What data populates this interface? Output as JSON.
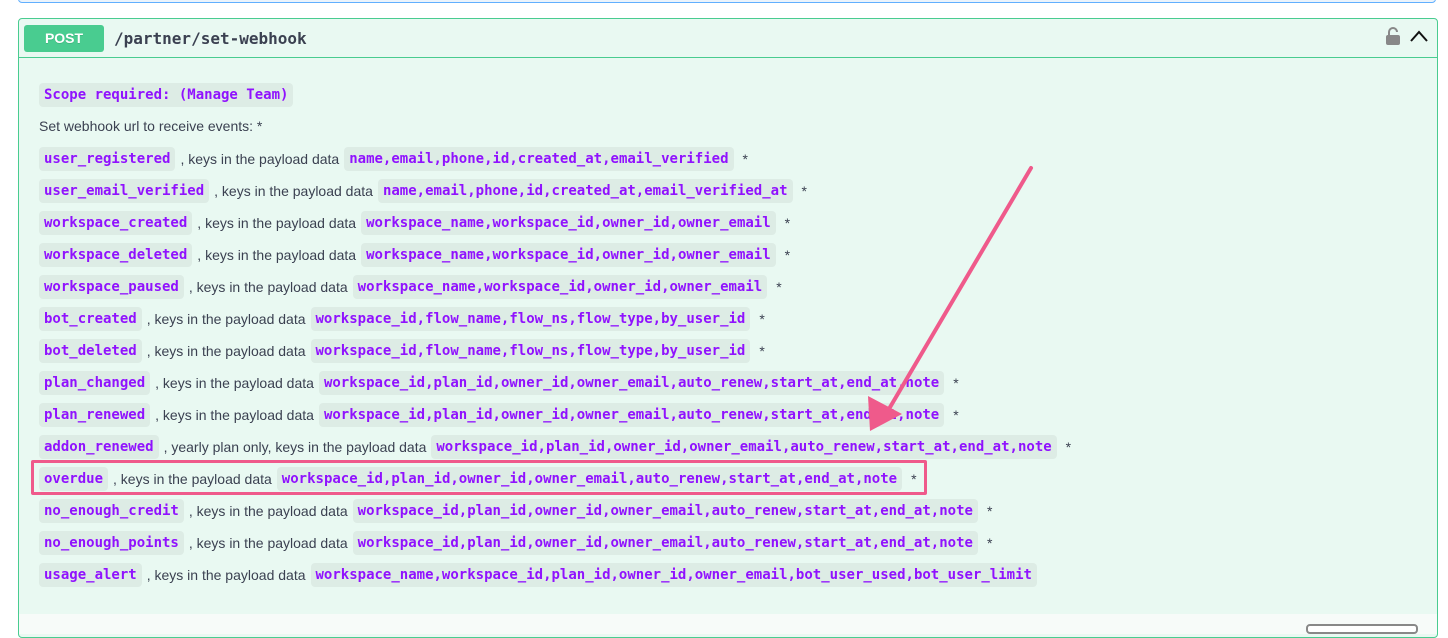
{
  "operation": {
    "method": "POST",
    "path": "/partner/set-webhook",
    "method_color": "#49cc90"
  },
  "scope": "Scope required: (Manage Team)",
  "intro": "Set webhook url to receive events: *",
  "events": [
    {
      "name": "user_registered",
      "text": ", keys in the payload data",
      "keys": "name,email,phone,id,created_at,email_verified",
      "star": "*"
    },
    {
      "name": "user_email_verified",
      "text": ", keys in the payload data",
      "keys": "name,email,phone,id,created_at,email_verified_at",
      "star": "*"
    },
    {
      "name": "workspace_created",
      "text": ", keys in the payload data",
      "keys": "workspace_name,workspace_id,owner_id,owner_email",
      "star": "*"
    },
    {
      "name": "workspace_deleted",
      "text": ", keys in the payload data",
      "keys": "workspace_name,workspace_id,owner_id,owner_email",
      "star": "*"
    },
    {
      "name": "workspace_paused",
      "text": ", keys in the payload data",
      "keys": "workspace_name,workspace_id,owner_id,owner_email",
      "star": "*"
    },
    {
      "name": "bot_created",
      "text": ", keys in the payload data",
      "keys": "workspace_id,flow_name,flow_ns,flow_type,by_user_id",
      "star": "*"
    },
    {
      "name": "bot_deleted",
      "text": ", keys in the payload data",
      "keys": "workspace_id,flow_name,flow_ns,flow_type,by_user_id",
      "star": "*"
    },
    {
      "name": "plan_changed",
      "text": ", keys in the payload data",
      "keys": "workspace_id,plan_id,owner_id,owner_email,auto_renew,start_at,end_at,note",
      "star": "*"
    },
    {
      "name": "plan_renewed",
      "text": ", keys in the payload data",
      "keys": "workspace_id,plan_id,owner_id,owner_email,auto_renew,start_at,end_at,note",
      "star": "*"
    },
    {
      "name": "addon_renewed",
      "text": ", yearly plan only, keys in the payload data",
      "keys": "workspace_id,plan_id,owner_id,owner_email,auto_renew,start_at,end_at,note",
      "star": "*"
    },
    {
      "name": "overdue",
      "text": ", keys in the payload data",
      "keys": "workspace_id,plan_id,owner_id,owner_email,auto_renew,start_at,end_at,note",
      "star": "*"
    },
    {
      "name": "no_enough_credit",
      "text": ", keys in the payload data",
      "keys": "workspace_id,plan_id,owner_id,owner_email,auto_renew,start_at,end_at,note",
      "star": "*"
    },
    {
      "name": "no_enough_points",
      "text": ", keys in the payload data",
      "keys": "workspace_id,plan_id,owner_id,owner_email,auto_renew,start_at,end_at,note",
      "star": "*"
    },
    {
      "name": "usage_alert",
      "text": ", keys in the payload data",
      "keys": "workspace_name,workspace_id,plan_id,owner_id,owner_email,bot_user_used,bot_user_limit",
      "star": ""
    }
  ],
  "annotation": {
    "color": "#ef5a8b",
    "highlighted_event": "overdue"
  },
  "icons": {
    "lock": "lock-icon",
    "collapse": "chevron-up-icon"
  }
}
